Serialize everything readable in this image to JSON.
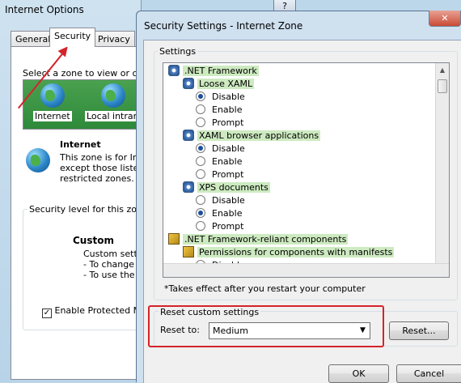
{
  "back_window": {
    "title": "Internet Options",
    "title_buttons": {
      "help": "?",
      "close": "✕"
    },
    "tabs": [
      "General",
      "Security",
      "Privacy"
    ],
    "zone_prompt": "Select a zone to view or chan",
    "zones": [
      {
        "label": "Internet",
        "icon": "globe-icon"
      },
      {
        "label": "Local intrane",
        "icon": "computer-network-icon"
      }
    ],
    "zone_info": {
      "title": "Internet",
      "lines": [
        "This zone is for Inte",
        "except those listed i",
        "restricted zones."
      ]
    },
    "security_level_label": "Security level for this zone",
    "custom": {
      "title": "Custom",
      "lines": [
        "Custom settin",
        "- To change t",
        "- To use the r"
      ]
    },
    "protected_mode": {
      "label": "Enable Protected Mo",
      "checked": true
    }
  },
  "dialog": {
    "title": "Security Settings - Internet Zone",
    "settings_label": "Settings",
    "tree": [
      {
        "type": "category",
        "text": ".NET Framework",
        "icon": "settings-icon",
        "indent": 0
      },
      {
        "type": "group",
        "text": "Loose XAML",
        "icon": "settings-icon",
        "indent": 1
      },
      {
        "type": "option",
        "text": "Disable",
        "selected": true,
        "indent": 2
      },
      {
        "type": "option",
        "text": "Enable",
        "selected": false,
        "indent": 2
      },
      {
        "type": "option",
        "text": "Prompt",
        "selected": false,
        "indent": 2
      },
      {
        "type": "group",
        "text": "XAML browser applications",
        "icon": "settings-icon",
        "indent": 1
      },
      {
        "type": "option",
        "text": "Disable",
        "selected": true,
        "indent": 2
      },
      {
        "type": "option",
        "text": "Enable",
        "selected": false,
        "indent": 2
      },
      {
        "type": "option",
        "text": "Prompt",
        "selected": false,
        "indent": 2
      },
      {
        "type": "group",
        "text": "XPS documents",
        "icon": "settings-icon",
        "indent": 1
      },
      {
        "type": "option",
        "text": "Disable",
        "selected": false,
        "indent": 2
      },
      {
        "type": "option",
        "text": "Enable",
        "selected": true,
        "indent": 2
      },
      {
        "type": "option",
        "text": "Prompt",
        "selected": false,
        "indent": 2
      },
      {
        "type": "category",
        "text": ".NET Framework-reliant components",
        "icon": "shield-icon",
        "indent": 0
      },
      {
        "type": "group",
        "text": "Permissions for components with manifests",
        "icon": "shield-icon",
        "indent": 1
      },
      {
        "type": "option",
        "text": "Disable",
        "selected": false,
        "indent": 2
      }
    ],
    "note": "*Takes effect after you restart your computer",
    "reset_group_label": "Reset custom settings",
    "reset_to_label": "Reset to:",
    "reset_to_value": "Medium",
    "reset_button": "Reset...",
    "ok_button": "OK",
    "cancel_button": "Cancel"
  },
  "colors": {
    "highlight_green": "#cdeac0",
    "annotation_red": "#d4242a"
  }
}
